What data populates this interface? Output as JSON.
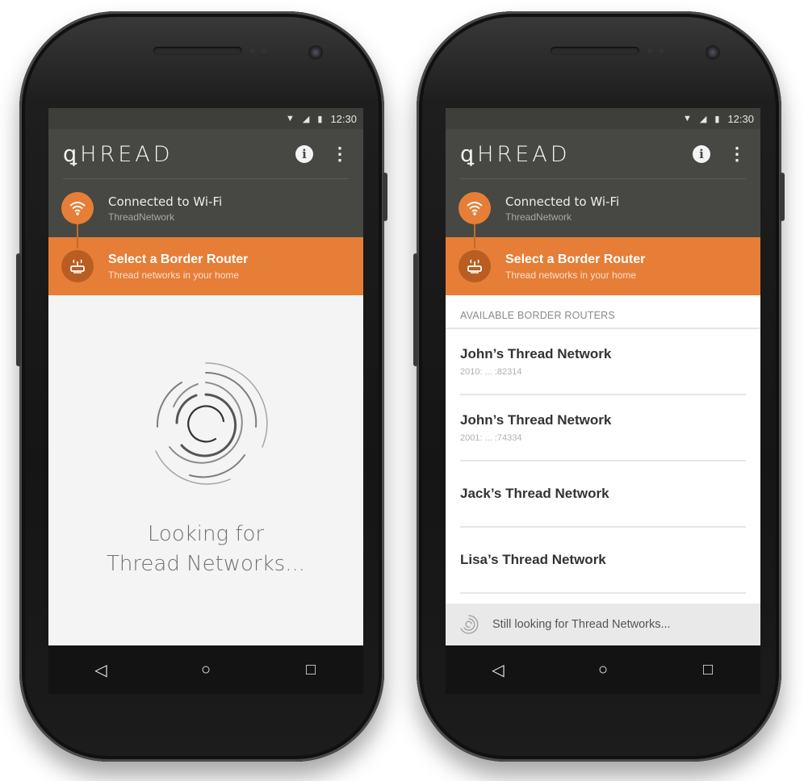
{
  "status_bar": {
    "time": "12:30"
  },
  "app": {
    "logo_text": "ꝗHREAD"
  },
  "steps": {
    "wifi": {
      "title": "Connected to Wi-Fi",
      "subtitle": "ThreadNetwork"
    },
    "router": {
      "title": "Select a Border Router",
      "subtitle": "Thread networks in your home"
    }
  },
  "left_phone": {
    "looking_line1": "Looking for",
    "looking_line2": "Thread Networks..."
  },
  "right_phone": {
    "section_header": "AVAILABLE BORDER ROUTERS",
    "routers": [
      {
        "name": "John’s Thread Network",
        "address": "2010: ... :82314"
      },
      {
        "name": "John’s Thread Network",
        "address": "2001: ... :74334"
      },
      {
        "name": "Jack’s Thread Network",
        "address": ""
      },
      {
        "name": "Lisa’s Thread Network",
        "address": ""
      }
    ],
    "banner_text": "Still looking for Thread Networks..."
  },
  "nav": {
    "back_icon": "◁",
    "home_icon": "○",
    "recents_icon": "□"
  },
  "colors": {
    "accent": "#e67e37",
    "appbar": "#474743",
    "statusbar": "#3e3e3b"
  }
}
